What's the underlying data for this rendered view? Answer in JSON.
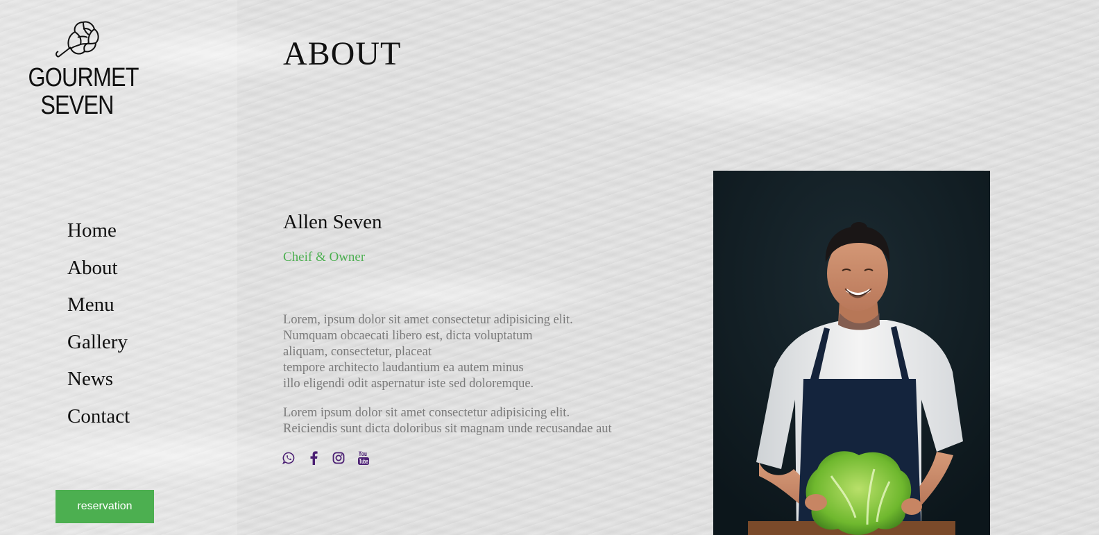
{
  "brand": {
    "name_line1": "GOURMET",
    "name_line2": "SEVEN",
    "logo_icon": "artichoke-icon"
  },
  "nav": {
    "items": [
      {
        "label": "Home"
      },
      {
        "label": "About"
      },
      {
        "label": "Menu"
      },
      {
        "label": "Gallery"
      },
      {
        "label": "News"
      },
      {
        "label": "Contact"
      }
    ]
  },
  "reservation": {
    "label": "reservation"
  },
  "page": {
    "title": "ABOUT"
  },
  "person": {
    "name": "Allen Seven",
    "role": "Cheif & Owner",
    "photo_icon": "chef-portrait-image"
  },
  "bio": {
    "paragraph1": [
      "Lorem, ipsum dolor sit amet consectetur adipisicing elit.",
      "Numquam obcaecati libero est, dicta voluptatum",
      "aliquam, consectetur, placeat",
      "tempore architecto laudantium ea autem minus",
      "illo eligendi odit aspernatur iste sed doloremque."
    ],
    "paragraph2": [
      "Lorem ipsum dolor sit amet consectetur adipisicing elit.",
      "Reiciendis sunt dicta doloribus sit magnam unde recusandae aut"
    ]
  },
  "socials": [
    {
      "icon": "whatsapp-icon"
    },
    {
      "icon": "facebook-icon"
    },
    {
      "icon": "instagram-icon"
    },
    {
      "icon": "youtube-icon"
    }
  ],
  "colors": {
    "accent": "#4caf50",
    "social": "#4b1f73",
    "body_text": "#7a7a7a",
    "heading": "#111111"
  }
}
